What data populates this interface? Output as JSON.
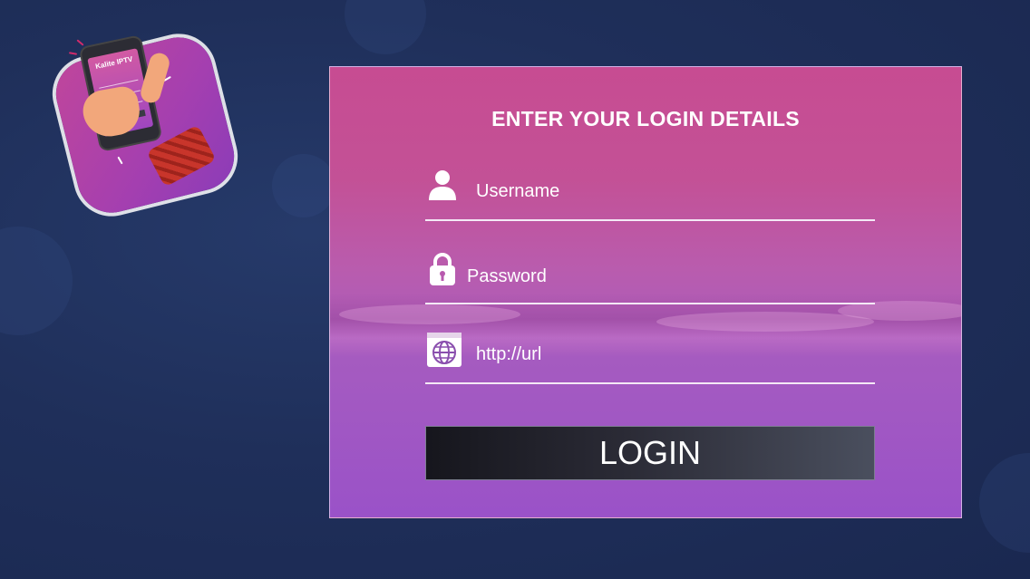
{
  "app_logo": {
    "name": "Kalite IPTV"
  },
  "login": {
    "title": "ENTER YOUR LOGIN DETAILS",
    "username_placeholder": "Username",
    "password_placeholder": "Password",
    "url_placeholder": "http://url",
    "login_label": "LOGIN"
  },
  "icons": {
    "username": "user-icon",
    "password": "lock-icon",
    "url": "globe-icon"
  },
  "colors": {
    "background": "#1f2f5a",
    "card_top": "#c74c92",
    "card_bottom": "#9a52c8",
    "button": "#2b2b36"
  }
}
